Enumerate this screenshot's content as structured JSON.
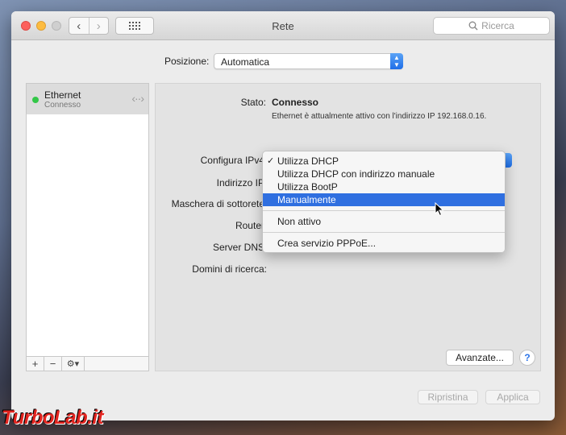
{
  "window": {
    "title": "Rete"
  },
  "toolbar": {
    "back": "‹",
    "forward": "›",
    "search_placeholder": "Ricerca"
  },
  "location": {
    "label": "Posizione:",
    "value": "Automatica"
  },
  "services": [
    {
      "name": "Ethernet",
      "status": "Connesso",
      "status_color": "#33c748"
    }
  ],
  "sidebar_tools": {
    "add": "+",
    "remove": "−",
    "gear": "⚙▾"
  },
  "details": {
    "status_label": "Stato:",
    "status_value": "Connesso",
    "status_desc": "Ethernet è attualmente attivo con l'indirizzo IP 192.168.0.16.",
    "ipv4_label": "Configura IPv4",
    "ip_label": "Indirizzo IP",
    "mask_label": "Maschera di sottorete",
    "router_label": "Router",
    "dns_label": "Server DNS",
    "domains_label": "Domini di ricerca:"
  },
  "ipv4_menu": {
    "items": [
      {
        "label": "Utilizza DHCP",
        "checked": true
      },
      {
        "label": "Utilizza DHCP con indirizzo manuale"
      },
      {
        "label": "Utilizza BootP"
      },
      {
        "label": "Manualmente",
        "highlighted": true
      },
      {
        "label": "Non attivo"
      },
      {
        "label": "Crea servizio PPPoE..."
      }
    ],
    "check_glyph": "✓",
    "highlight_color": "#2f6fe0"
  },
  "buttons": {
    "advanced": "Avanzate...",
    "help": "?",
    "revert": "Ripristina",
    "apply": "Applica"
  },
  "watermark": "TurboLab.it"
}
